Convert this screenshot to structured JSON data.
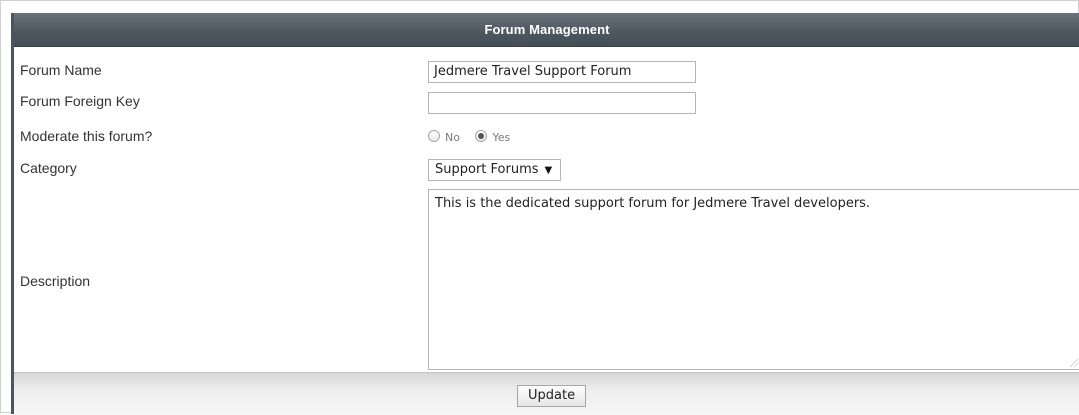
{
  "header": {
    "title": "Forum Management"
  },
  "fields": {
    "forum_name": {
      "label": "Forum Name",
      "value": "Jedmere Travel Support Forum"
    },
    "foreign_key": {
      "label": "Forum Foreign Key",
      "value": ""
    },
    "moderate": {
      "label": "Moderate this forum?",
      "options": [
        "No",
        "Yes"
      ],
      "selected": "Yes"
    },
    "category": {
      "label": "Category",
      "selected": "Support Forums",
      "arrow": "▼"
    },
    "description": {
      "label": "Description",
      "value": "This is the dedicated support forum for Jedmere Travel developers."
    }
  },
  "footer": {
    "update_label": "Update"
  }
}
